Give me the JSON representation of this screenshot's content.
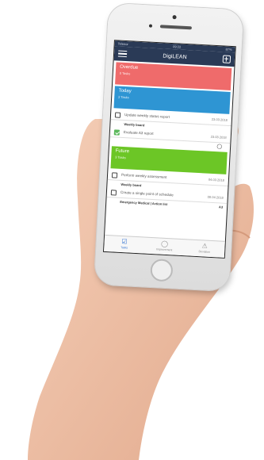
{
  "status": {
    "carrier": "Telenor",
    "time": "09:22",
    "battery": "87%"
  },
  "appbar": {
    "title": "DigiLEAN"
  },
  "sections": {
    "overdue": {
      "name": "Overdue",
      "count": "0 Tasks"
    },
    "today": {
      "name": "Today",
      "count": "2 Tasks"
    },
    "future": {
      "name": "Future",
      "count": "3 Tasks"
    }
  },
  "today_tasks": [
    {
      "title": "Update weekly status report",
      "date": "23.03.2018",
      "board": "Weekly board",
      "done": false
    },
    {
      "title": "Evaluate A3 report",
      "date": "23.03.2018",
      "board": "",
      "done": true
    }
  ],
  "future_tasks": [
    {
      "title": "Perform weekly assessment",
      "date": "04.03.2018",
      "board": "Weekly board"
    },
    {
      "title": "Create a single point of schedule",
      "date": "08.04.2018",
      "board": "Emergency Medical | Action list",
      "tag": "A3"
    }
  ],
  "tabbar": {
    "tasks": "Tasks",
    "improvement": "Improvement",
    "deviation": "Deviation"
  },
  "colors": {
    "overdue": "#ef6b6b",
    "today": "#2e95d3",
    "future": "#6cc626",
    "appbar": "#2a3a56"
  }
}
